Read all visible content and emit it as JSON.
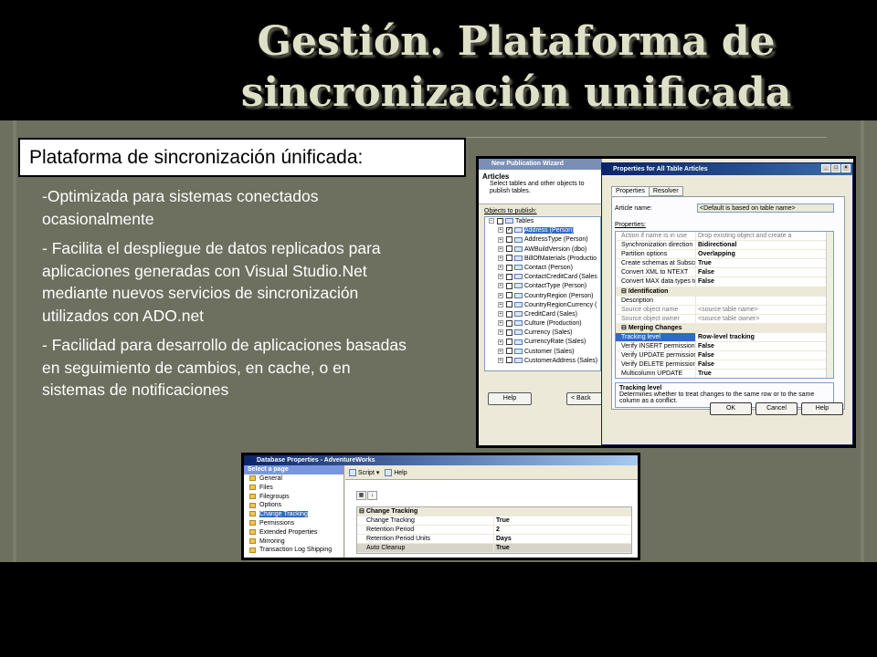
{
  "slide": {
    "title_line1": "Gestión. Plataforma de",
    "title_line2": "sincronización unificada",
    "subtitle_box": "Plataforma de sincronización únificada:",
    "bullets": [
      "-Optimizada para sistemas conectados ocasionalmente",
      "- Facilita el despliegue de datos replicados para aplicaciones generadas con Visual Studio.Net mediante nuevos servicios de sincronización utilizados con ADO.net",
      "- Facilidad para desarrollo de aplicaciones basadas en seguimiento de cambios, en cache, o en sistemas de notificaciones"
    ]
  },
  "wizard": {
    "title": "New Publication Wizard",
    "heading": "Articles",
    "description": "Select tables and other objects to publish tables.",
    "objects_label": "Objects to publish:",
    "tree_root": "Tables",
    "tree_items": [
      {
        "label": "Address (Person)",
        "checked": true,
        "selected": true
      },
      {
        "label": "AddressType (Person)",
        "checked": false
      },
      {
        "label": "AWBuildVersion (dbo)",
        "checked": false
      },
      {
        "label": "BillOfMaterials (Productio",
        "checked": false
      },
      {
        "label": "Contact (Person)",
        "checked": false
      },
      {
        "label": "ContactCreditCard (Sales",
        "checked": false
      },
      {
        "label": "ContactType (Person)",
        "checked": false
      },
      {
        "label": "CountryRegion (Person)",
        "checked": false
      },
      {
        "label": "CountryRegionCurrency (",
        "checked": false
      },
      {
        "label": "CreditCard (Sales)",
        "checked": false
      },
      {
        "label": "Culture (Production)",
        "checked": false
      },
      {
        "label": "Currency (Sales)",
        "checked": false
      },
      {
        "label": "CurrencyRate (Sales)",
        "checked": false
      },
      {
        "label": "Customer (Sales)",
        "checked": false
      },
      {
        "label": "CustomerAddress (Sales)",
        "checked": false
      }
    ],
    "help_button": "Help",
    "back_button": "< Back"
  },
  "properties": {
    "title": "Properties for All Table Articles",
    "tabs": [
      "Properties",
      "Resolver"
    ],
    "article_name_label": "Article name:",
    "article_name_value": "<Default is based on table name>",
    "properties_label": "Properties:",
    "rows": [
      {
        "name": "Action if name is in use",
        "value": "Drop existing object and create a",
        "kind": "dim"
      },
      {
        "name": "Synchronization direction",
        "value": "Bidirectional",
        "kind": "row"
      },
      {
        "name": "Partition options",
        "value": "Overlapping",
        "kind": "row"
      },
      {
        "name": "Create schemas at Subscribe",
        "value": "True",
        "kind": "row"
      },
      {
        "name": "Convert XML to NTEXT",
        "value": "False",
        "kind": "row"
      },
      {
        "name": "Convert MAX data types to N",
        "value": "False",
        "kind": "row"
      },
      {
        "name": "Identification",
        "value": "",
        "kind": "cat"
      },
      {
        "name": "Description",
        "value": "",
        "kind": "row"
      },
      {
        "name": "Source object name",
        "value": "<source table name>",
        "kind": "dim"
      },
      {
        "name": "Source object owner",
        "value": "<source table owner>",
        "kind": "dim"
      },
      {
        "name": "Merging Changes",
        "value": "",
        "kind": "cat"
      },
      {
        "name": "Tracking level",
        "value": "Row-level tracking",
        "kind": "hl"
      },
      {
        "name": "Verify INSERT permission",
        "value": "False",
        "kind": "row"
      },
      {
        "name": "Verify UPDATE permission",
        "value": "False",
        "kind": "row"
      },
      {
        "name": "Verify DELETE permission",
        "value": "False",
        "kind": "row"
      },
      {
        "name": "Multicolumn UPDATE",
        "value": "True",
        "kind": "row"
      }
    ],
    "desc_title": "Tracking level",
    "desc_text": "Determines whether to treat changes to the same row or to the same column as a conflict.",
    "ok_button": "OK",
    "cancel_button": "Cancel",
    "help_button": "Help"
  },
  "db_props": {
    "title": "Database Properties - AdventureWorks",
    "select_page": "Select a page",
    "pages": [
      "General",
      "Files",
      "Filegroups",
      "Options",
      "Change Tracking",
      "Permissions",
      "Extended Properties",
      "Mirroring",
      "Transaction Log Shipping"
    ],
    "selected_page": "Change Tracking",
    "script_label": "Script",
    "help_label": "Help",
    "category": "Change Tracking",
    "rows": [
      {
        "name": "Change Tracking",
        "value": "True"
      },
      {
        "name": "Retention Period",
        "value": "2"
      },
      {
        "name": "Retention Period Units",
        "value": "Days"
      },
      {
        "name": "Auto Cleanup",
        "value": "True"
      }
    ]
  }
}
